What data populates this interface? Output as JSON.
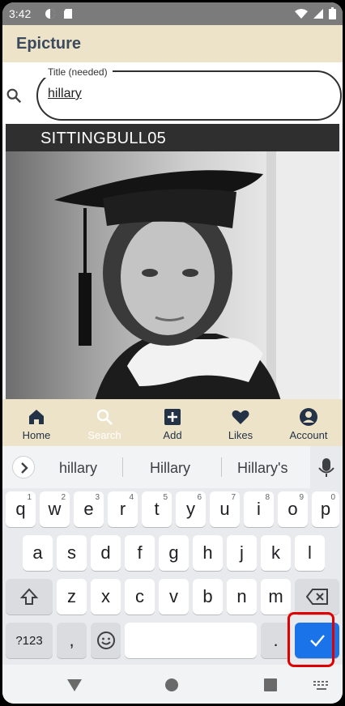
{
  "status": {
    "time": "3:42"
  },
  "app": {
    "title": "Epicture"
  },
  "search": {
    "label": "Title (needed)",
    "value": "hillary"
  },
  "card": {
    "username": "SITTINGBULL05"
  },
  "bottom_nav": [
    {
      "label": "Home",
      "icon": "home-icon",
      "active": false
    },
    {
      "label": "Search",
      "icon": "search-icon",
      "active": true
    },
    {
      "label": "Add",
      "icon": "add-icon",
      "active": false
    },
    {
      "label": "Likes",
      "icon": "heart-icon",
      "active": false
    },
    {
      "label": "Account",
      "icon": "account-icon",
      "active": false
    }
  ],
  "keyboard": {
    "suggestions": [
      "hillary",
      "Hillary",
      "Hillary's"
    ],
    "row1": [
      {
        "k": "q",
        "n": "1"
      },
      {
        "k": "w",
        "n": "2"
      },
      {
        "k": "e",
        "n": "3"
      },
      {
        "k": "r",
        "n": "4"
      },
      {
        "k": "t",
        "n": "5"
      },
      {
        "k": "y",
        "n": "6"
      },
      {
        "k": "u",
        "n": "7"
      },
      {
        "k": "i",
        "n": "8"
      },
      {
        "k": "o",
        "n": "9"
      },
      {
        "k": "p",
        "n": "0"
      }
    ],
    "row2": [
      "a",
      "s",
      "d",
      "f",
      "g",
      "h",
      "j",
      "k",
      "l"
    ],
    "row3": [
      "z",
      "x",
      "c",
      "v",
      "b",
      "n",
      "m"
    ],
    "symbols_label": "?123",
    "comma": ",",
    "period": "."
  },
  "colors": {
    "appbar": "#ede3c8",
    "accent": "#1a73e8",
    "highlight": "#e00000"
  }
}
